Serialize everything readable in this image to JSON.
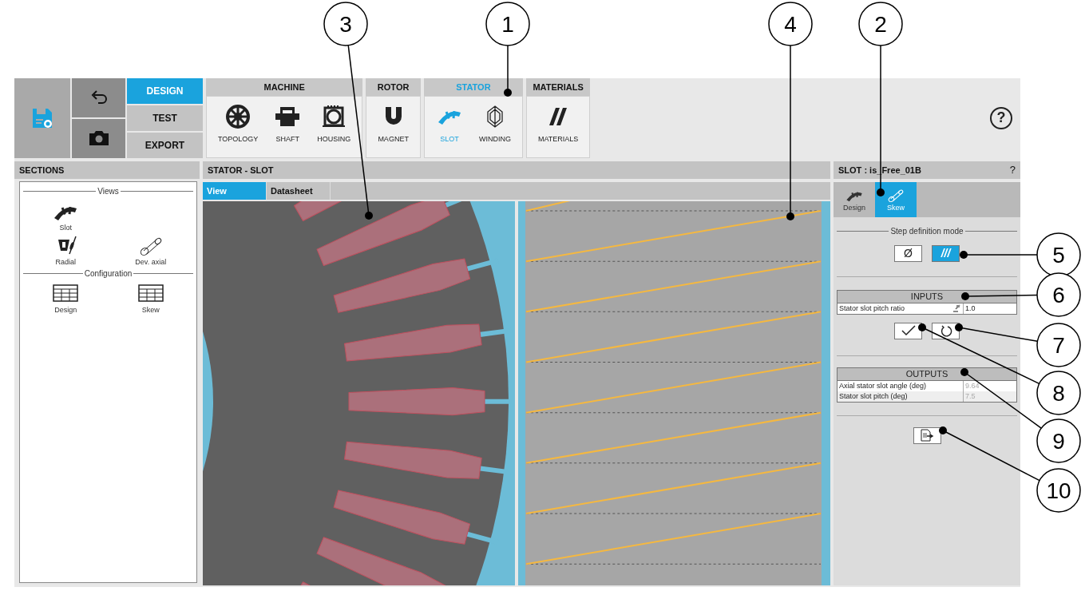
{
  "toolbar": {
    "modes": [
      {
        "label": "DESIGN",
        "selected": true
      },
      {
        "label": "TEST",
        "selected": false
      },
      {
        "label": "EXPORT",
        "selected": false
      }
    ],
    "groups": [
      {
        "title": "MACHINE",
        "selected": false,
        "items": [
          {
            "label": "TOPOLOGY",
            "selected": false
          },
          {
            "label": "SHAFT",
            "selected": false
          },
          {
            "label": "HOUSING",
            "selected": false
          }
        ]
      },
      {
        "title": "ROTOR",
        "selected": false,
        "items": [
          {
            "label": "MAGNET",
            "selected": false
          }
        ]
      },
      {
        "title": "STATOR",
        "selected": true,
        "items": [
          {
            "label": "SLOT",
            "selected": true
          },
          {
            "label": "WINDING",
            "selected": false
          }
        ]
      },
      {
        "title": "MATERIALS",
        "selected": false,
        "items": [
          {
            "label": "MATERIALS",
            "selected": false
          }
        ]
      }
    ],
    "help": "?"
  },
  "sections": {
    "title": "SECTIONS",
    "groups": [
      {
        "heading": "Views",
        "items": [
          {
            "label": "Slot"
          },
          {
            "label": "Radial"
          },
          {
            "label": "Dev. axial"
          }
        ]
      },
      {
        "heading": "Configuration",
        "items": [
          {
            "label": "Design"
          },
          {
            "label": "Skew"
          }
        ]
      }
    ]
  },
  "main": {
    "title": "STATOR - SLOT",
    "tabs": [
      {
        "label": "View",
        "selected": true
      },
      {
        "label": "Datasheet",
        "selected": false
      }
    ]
  },
  "panel": {
    "title": "SLOT : is_Free_01B",
    "help": "?",
    "tabs": [
      {
        "label": "Design",
        "selected": false
      },
      {
        "label": "Skew",
        "selected": true
      }
    ],
    "step_mode": {
      "label": "Step definition mode",
      "options": [
        {
          "symbol": "Ø",
          "selected": false
        },
        {
          "symbol": "///",
          "selected": true
        }
      ]
    },
    "inputs": {
      "title": "INPUTS",
      "rows": [
        {
          "label": "Stator slot pitch ratio",
          "value": "1.0"
        }
      ]
    },
    "outputs": {
      "title": "OUTPUTS",
      "rows": [
        {
          "label": "Axial stator slot angle (deg)",
          "value": "9.64"
        },
        {
          "label": "Stator slot pitch (deg)",
          "value": "7.5"
        }
      ]
    }
  },
  "callouts": [
    {
      "label": "3"
    },
    {
      "label": "1"
    },
    {
      "label": "4"
    },
    {
      "label": "2"
    },
    {
      "label": "5"
    },
    {
      "label": "6"
    },
    {
      "label": "7"
    },
    {
      "label": "8"
    },
    {
      "label": "9"
    },
    {
      "label": "10"
    }
  ]
}
